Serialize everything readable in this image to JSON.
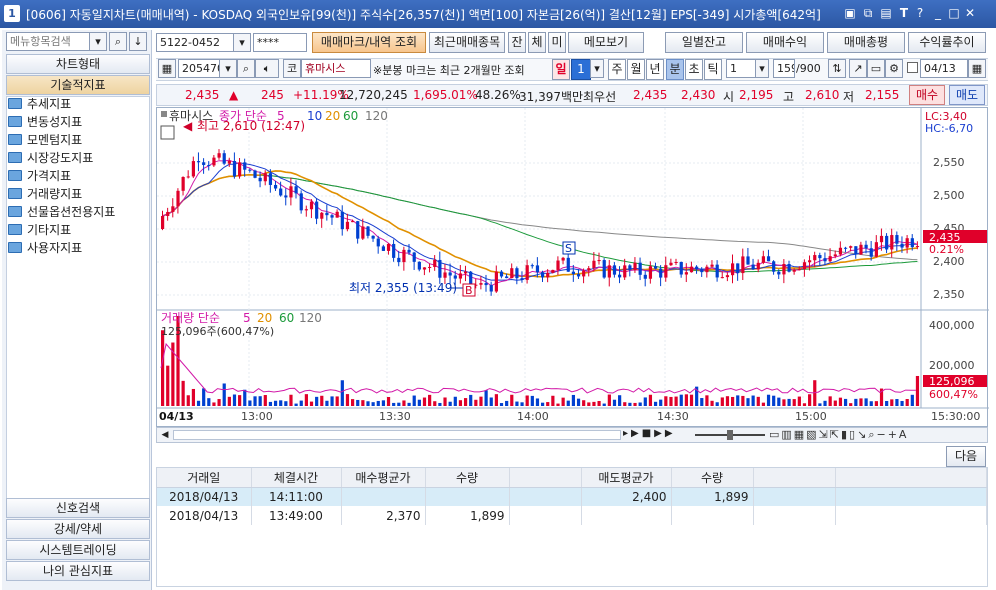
{
  "titlebar": {
    "number": "1",
    "text": "[0606] 자동일지차트(매매내역) - KOSDAQ 외국인보유[99(천)] 주식수[26,357(천)] 액면[100] 자본금[26(억)] 결산[12월] EPS[-349] 시가총액[642억]",
    "icons": [
      "restore-icon",
      "pin-icon",
      "tile-icon",
      "font-icon",
      "help-icon",
      "minimize-icon",
      "maximize-icon",
      "close-icon"
    ]
  },
  "sidebar": {
    "search_placeholder": "메뉴항목검색",
    "head_chart_type": "차트형태",
    "head_technical": "기술적지표",
    "items": [
      "추세지표",
      "변동성지표",
      "모멘텀지표",
      "시장강도지표",
      "가격지표",
      "거래량지표",
      "선물옵션전용지표",
      "기타지표",
      "사용자지표"
    ],
    "bottom": [
      "신호검색",
      "강세/약세",
      "시스템트레이딩",
      "나의 관심지표"
    ]
  },
  "toolbar1": {
    "account": "5122-0452",
    "password": "****",
    "buttons": [
      "매매마크/내역 조회",
      "최근매매종목",
      "잔",
      "체",
      "미",
      "메모보기",
      "일별잔고",
      "매매수익",
      "매매총평",
      "수익률추이"
    ]
  },
  "toolbar2": {
    "code": "205470",
    "market": "코",
    "stock_name": "휴마시스",
    "notice": "※분봉 마크는 최근 2개월만 조회",
    "periods": [
      "일",
      "1",
      "주",
      "월",
      "년",
      "분",
      "초",
      "틱"
    ],
    "interval": "1",
    "count": "159",
    "count_max": "/900",
    "date": "04/13"
  },
  "info": {
    "price": "2,435",
    "change": "245",
    "change_pct": "+11.19%",
    "volume": "12,720,245",
    "vol_ratio": "1,695.01%",
    "turnover": "48.26%",
    "amount": "31,397백만",
    "best_label": "최우선",
    "best_ask": "2,435",
    "best_bid": "2,430",
    "open_l": "시",
    "open": "2,195",
    "high_l": "고",
    "high": "2,610",
    "low_l": "저",
    "low": "2,155",
    "buy": "매수",
    "sell": "매도"
  },
  "chart": {
    "legend_name": "휴마시스",
    "legend_ma": "종가 단순",
    "ma": [
      "5",
      "10",
      "20",
      "60",
      "120"
    ],
    "high_label": "최고 2,610 (12:47)",
    "low_label": "최저 2,355 (13:49)",
    "lc": "LC:3,40",
    "hc": "HC:-6,70",
    "price_axis": [
      "2,550",
      "2,500",
      "2,450",
      "2,400",
      "2,350"
    ],
    "cur_price": "2,435",
    "cur_pct": "0.21%",
    "vol_legend": "거래량 단순",
    "vol_ma": [
      "5",
      "20",
      "60",
      "120"
    ],
    "vol_note": "125,096주(600,47%)",
    "vol_axis": [
      "400,000",
      "200,000"
    ],
    "vol_cur": "125,096",
    "vol_pct": "600,47%",
    "time_axis": [
      "04/13",
      "13:00",
      "13:30",
      "14:00",
      "14:30",
      "15:00",
      "15:30:00"
    ],
    "mark_sell": "S",
    "mark_buy": "B"
  },
  "next_button": "다음",
  "table": {
    "headers": [
      "거래일",
      "체결시간",
      "매수평균가",
      "수량",
      "",
      "매도평균가",
      "수량",
      "",
      ""
    ],
    "rows": [
      [
        "2018/04/13",
        "14:11:00",
        "",
        "",
        "",
        "2,400",
        "1,899",
        "",
        ""
      ],
      [
        "2018/04/13",
        "13:49:00",
        "2,370",
        "1,899",
        "",
        "",
        "",
        "",
        ""
      ]
    ]
  },
  "colors": {
    "up": "#e0002a",
    "down": "#0040d0",
    "accent": "#2b6fd6"
  }
}
